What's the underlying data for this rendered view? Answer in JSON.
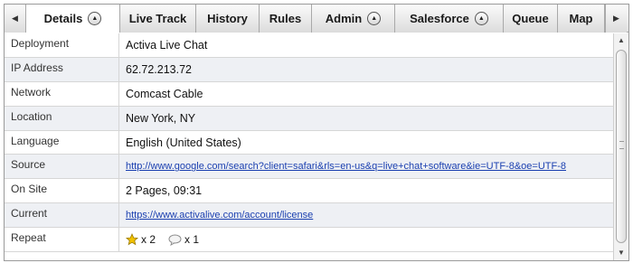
{
  "tabs": {
    "prev_arrow": "◀",
    "next_arrow": "▶",
    "items": [
      {
        "label": "Details",
        "badge": "▲"
      },
      {
        "label": "Live Track"
      },
      {
        "label": "History"
      },
      {
        "label": "Rules"
      },
      {
        "label": "Admin",
        "badge": "▲"
      },
      {
        "label": "Salesforce",
        "badge": "▲"
      },
      {
        "label": "Queue"
      },
      {
        "label": "Map"
      }
    ]
  },
  "details": {
    "deployment": {
      "label": "Deployment",
      "value": "Activa Live Chat"
    },
    "ip": {
      "label": "IP Address",
      "value": "62.72.213.72"
    },
    "network": {
      "label": "Network",
      "value": "Comcast Cable"
    },
    "location": {
      "label": "Location",
      "value": "New York, NY"
    },
    "language": {
      "label": "Language",
      "value": "English (United States)"
    },
    "source": {
      "label": "Source",
      "value": "http://www.google.com/search?client=safari&rls=en-us&q=live+chat+software&ie=UTF-8&oe=UTF-8"
    },
    "onsite": {
      "label": "On Site",
      "value": "2 Pages, 09:31"
    },
    "current": {
      "label": "Current",
      "value": "https://www.activalive.com/account/license"
    },
    "repeat": {
      "label": "Repeat",
      "visits_count": "x 2",
      "chats_count": "x 1"
    }
  },
  "colors": {
    "link": "#1a3fb0",
    "star": "#f2c200",
    "row_alt": "#eef0f4"
  }
}
